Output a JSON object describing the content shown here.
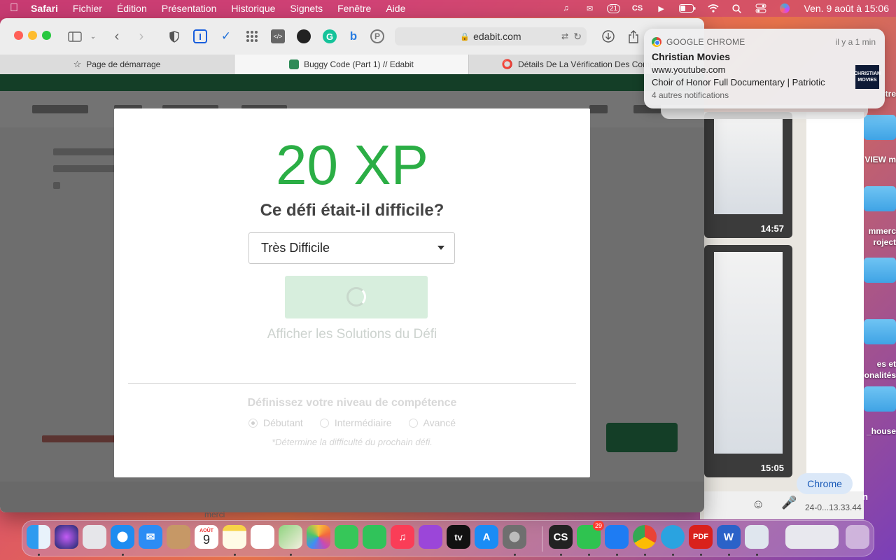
{
  "menubar": {
    "apple_icon": "apple-icon",
    "app_name": "Safari",
    "menus": [
      "Fichier",
      "Édition",
      "Présentation",
      "Historique",
      "Signets",
      "Fenêtre",
      "Aide"
    ],
    "status_icons": [
      "support-icon",
      "message-icon",
      "notification-count-icon",
      "cs-icon",
      "play-icon",
      "battery-icon",
      "wifi-icon",
      "search-icon",
      "control-center-icon",
      "siri-icon"
    ],
    "notification_count": "21",
    "cs_label": "CS",
    "clock": "Ven. 9 août à  15:06"
  },
  "safari": {
    "url": "edabit.com",
    "toolbar_icons": [
      "sidebar-icon",
      "chevron-down-icon",
      "back-icon",
      "forward-icon",
      "shield-icon",
      "bitwarden-icon",
      "pocket-icon",
      "grid-icon",
      "code-icon",
      "github-icon",
      "grammarly-icon",
      "bing-icon",
      "pinterest-icon",
      "translate-icon",
      "reload-icon",
      "download-icon",
      "share-icon"
    ],
    "tabs": [
      {
        "label": "Page de démarrage",
        "icon": "star-icon",
        "active": false
      },
      {
        "label": "Buggy Code (Part 1) // Edabit",
        "icon": "edabit-icon",
        "active": true
      },
      {
        "label": "Détails De La Vérification Des Compéten",
        "icon": "opera-icon",
        "active": false
      }
    ]
  },
  "modal": {
    "xp": "20 XP",
    "question": "Ce défi était-il difficile?",
    "difficulty_selected": "Très Difficile",
    "solutions_link": "Afficher les Solutions du Défi",
    "skill_title": "Définissez votre niveau de compétence",
    "skill_options": [
      "Débutant",
      "Intermédiaire",
      "Avancé"
    ],
    "skill_selected": "Débutant",
    "skill_note": "*Détermine la difficulté du prochain défi."
  },
  "notification": {
    "app": "GOOGLE CHROME",
    "time": "il y a 1 min",
    "title": "Christian Movies",
    "line1": "www.youtube.com",
    "line2": "Choir of Honor Full Documentary | Patriotic",
    "more": "4 autres notifications",
    "thumb_text": "CHRISTIAN MOVIES"
  },
  "background": {
    "desktop_labels": [
      "itre",
      "VIEW m",
      "mmerc",
      "roject",
      "es et",
      "onalités",
      "_house"
    ],
    "whatsapp_times": [
      "14:57",
      "15:05"
    ],
    "chrome_label": "Chrome",
    "file_label": "24-0...13.33.44",
    "merci": "merci",
    "n_label": "n"
  },
  "dock": {
    "apps": [
      "finder",
      "siri",
      "launchpad",
      "safari",
      "mail",
      "contacts",
      "calendar",
      "notes",
      "reminders",
      "maps",
      "photos",
      "messages",
      "facetime",
      "music",
      "podcasts",
      "apple-tv",
      "app-store",
      "system-settings",
      "cs",
      "whatsapp",
      "messenger",
      "chrome",
      "telegram",
      "pdf",
      "word",
      "preview",
      "recent-files",
      "trash"
    ],
    "calendar_month": "AOÛT",
    "calendar_day": "9",
    "whatsapp_badge": "29",
    "cs_label": "CS",
    "tv_label": "tv",
    "pdf_label": "PDF",
    "word_label": "W"
  }
}
